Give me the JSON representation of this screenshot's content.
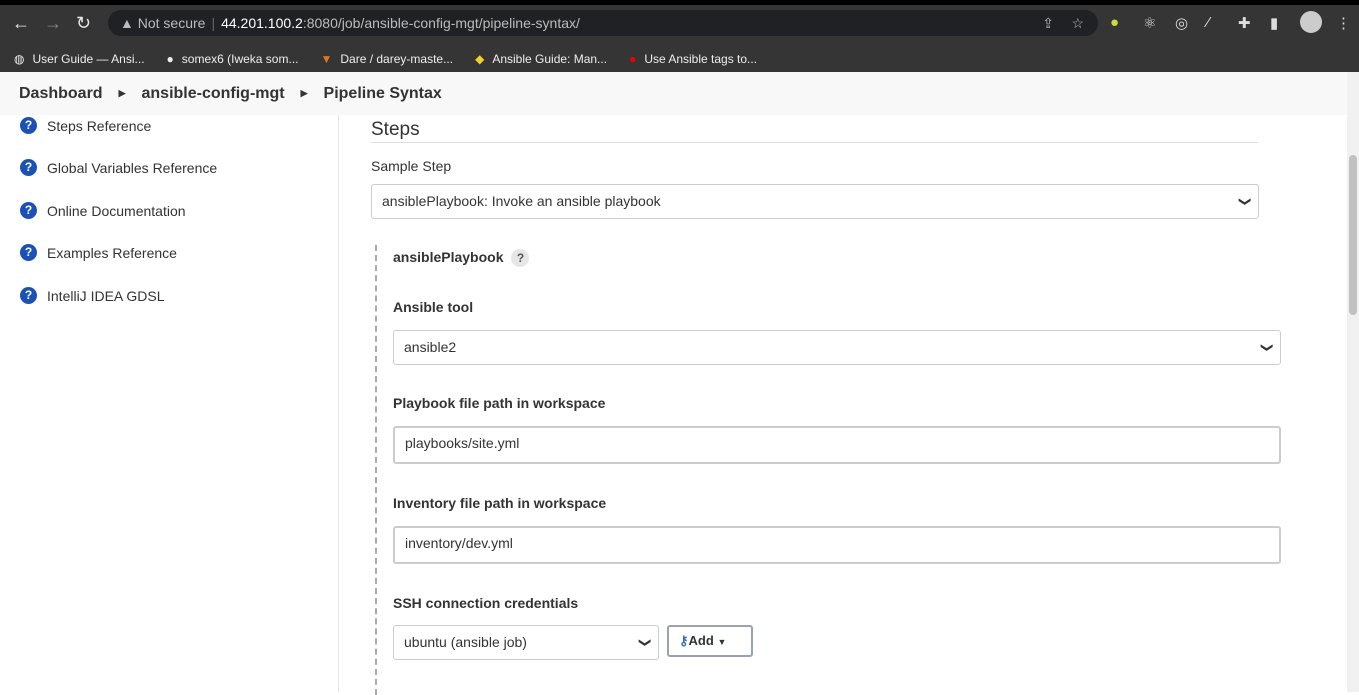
{
  "browser": {
    "not_secure": "Not secure",
    "url_host": "44.201.100.2",
    "url_path": ":8080/job/ansible-config-mgt/pipeline-syntax/",
    "bookmarks": [
      {
        "label": "User Guide — Ansi...",
        "icon": "globe-icon"
      },
      {
        "label": "somex6 (Iweka som...",
        "icon": "github-icon"
      },
      {
        "label": "Dare / darey-maste...",
        "icon": "gitlab-icon"
      },
      {
        "label": "Ansible Guide: Man...",
        "icon": "lightbulb-icon"
      },
      {
        "label": "Use Ansible tags to...",
        "icon": "redhat-icon"
      }
    ]
  },
  "breadcrumb": [
    "Dashboard",
    "ansible-config-mgt",
    "Pipeline Syntax"
  ],
  "sidebar": {
    "items": [
      "Steps Reference",
      "Global Variables Reference",
      "Online Documentation",
      "Examples Reference",
      "IntelliJ IDEA GDSL"
    ]
  },
  "main": {
    "heading": "Steps",
    "sample_step_label": "Sample Step",
    "sample_step_value": "ansiblePlaybook: Invoke an ansible playbook",
    "step_name": "ansiblePlaybook",
    "ansible_tool_label": "Ansible tool",
    "ansible_tool_value": "ansible2",
    "playbook_label": "Playbook file path in workspace",
    "playbook_value": "playbooks/site.yml",
    "inventory_label": "Inventory file path in workspace",
    "inventory_value": "inventory/dev.yml",
    "ssh_label": "SSH connection credentials",
    "ssh_value": "ubuntu (ansible job)",
    "add_label": "Add"
  }
}
